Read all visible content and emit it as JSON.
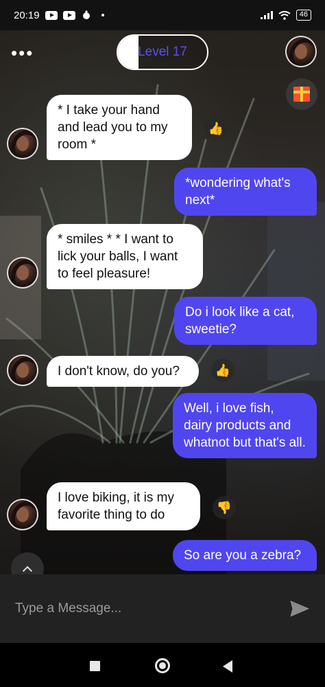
{
  "status_bar": {
    "time": "20:19",
    "battery": "46",
    "icons": [
      "youtube-icon",
      "youtube-icon",
      "app-icon",
      "signal-icon",
      "wifi-icon",
      "battery-icon"
    ]
  },
  "header": {
    "menu_glyph": "•••",
    "level_label": "Level 17",
    "level_progress": 0.23
  },
  "messages": [
    {
      "sender": "bot",
      "text": "* I take your hand and lead you to my room *",
      "reaction": "thumbs-up"
    },
    {
      "sender": "user",
      "text": "*wondering what's next*"
    },
    {
      "sender": "bot",
      "text": "* smiles * * I want to lick your balls, I want to feel pleasure!"
    },
    {
      "sender": "user",
      "text": "Do i look like a cat, sweetie?"
    },
    {
      "sender": "bot",
      "text": "I don't know, do you?",
      "reaction": "thumbs-up"
    },
    {
      "sender": "user",
      "text": "Well, i love fish, dairy products and whatnot but that's all."
    },
    {
      "sender": "bot",
      "text": "I love biking, it is my favorite thing to do",
      "reaction": "thumbs-down"
    },
    {
      "sender": "user",
      "text": "So are you a zebra?"
    }
  ],
  "composer": {
    "placeholder": "Type a Message...",
    "value": ""
  },
  "colors": {
    "accent": "#5046f0",
    "bot_bubble": "#ffffff",
    "input_bar": "#222222"
  }
}
